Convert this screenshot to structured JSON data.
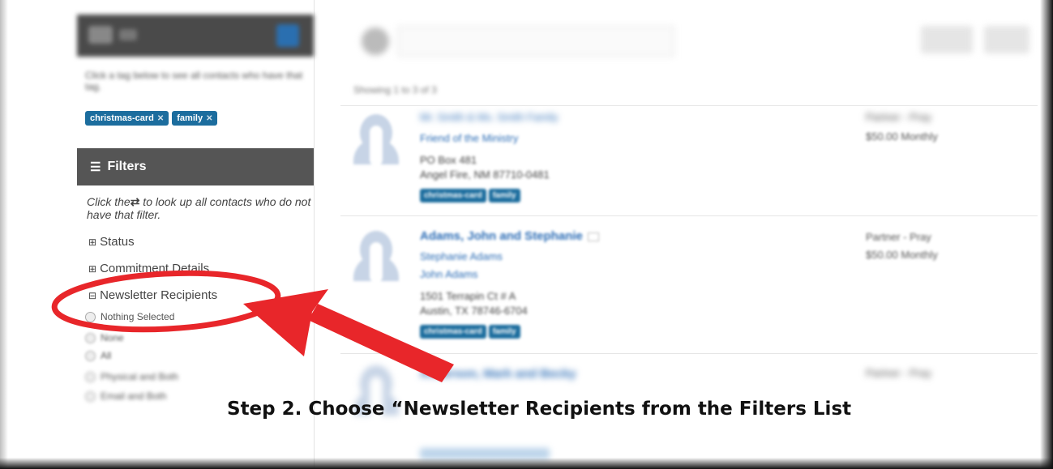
{
  "sidebar": {
    "top_bar_blurred": true,
    "tag_note_blurred": "Click a tag below to see all contacts who have that tag.",
    "active_tags": [
      "christmas-card",
      "family"
    ],
    "filters_title": "Filters",
    "filters_icon": "sliders-icon",
    "filter_help_prefix": "Click the",
    "filter_help_icon": "⇄",
    "filter_help_suffix": " to look up all contacts who do not have that filter.",
    "filter_groups": [
      {
        "label": "Status",
        "expanded": false
      },
      {
        "label": "Commitment Details",
        "expanded": false
      },
      {
        "label": "Newsletter Recipients",
        "expanded": true
      }
    ],
    "newsletter_options": [
      "Nothing Selected",
      "None",
      "All"
    ],
    "blurred_options": [
      "Physical and Both",
      "Email and Both"
    ]
  },
  "main": {
    "showing_text": "Showing 1 to 3 of 3",
    "contacts": [
      {
        "name": "Mr. Smith & Ms. Smith Family",
        "lines": [
          "Friend of the Ministry"
        ],
        "address": [
          "PO Box 481",
          "Angel Fire, NM 87710-0481"
        ],
        "tags": [
          "christmas-card",
          "family"
        ],
        "status": [
          "Partner - Pray",
          "$50.00 Monthly"
        ]
      },
      {
        "name": "Adams, John and Stephanie",
        "lines": [
          "Stephanie Adams",
          "John Adams"
        ],
        "address": [
          "1501 Terrapin Ct # A",
          "Austin, TX 78746-6704"
        ],
        "tags": [
          "christmas-card",
          "family"
        ],
        "status": [
          "Partner - Pray",
          "$50.00 Monthly"
        ]
      },
      {
        "name": "Anderson, Mark and Becky",
        "lines": [],
        "address": [],
        "tags": [],
        "status": [
          "Partner - Pray"
        ]
      }
    ]
  },
  "annotation": {
    "caption": "Step 2. Choose “Newsletter Recipients from the Filters List",
    "color": "#e8262a"
  }
}
